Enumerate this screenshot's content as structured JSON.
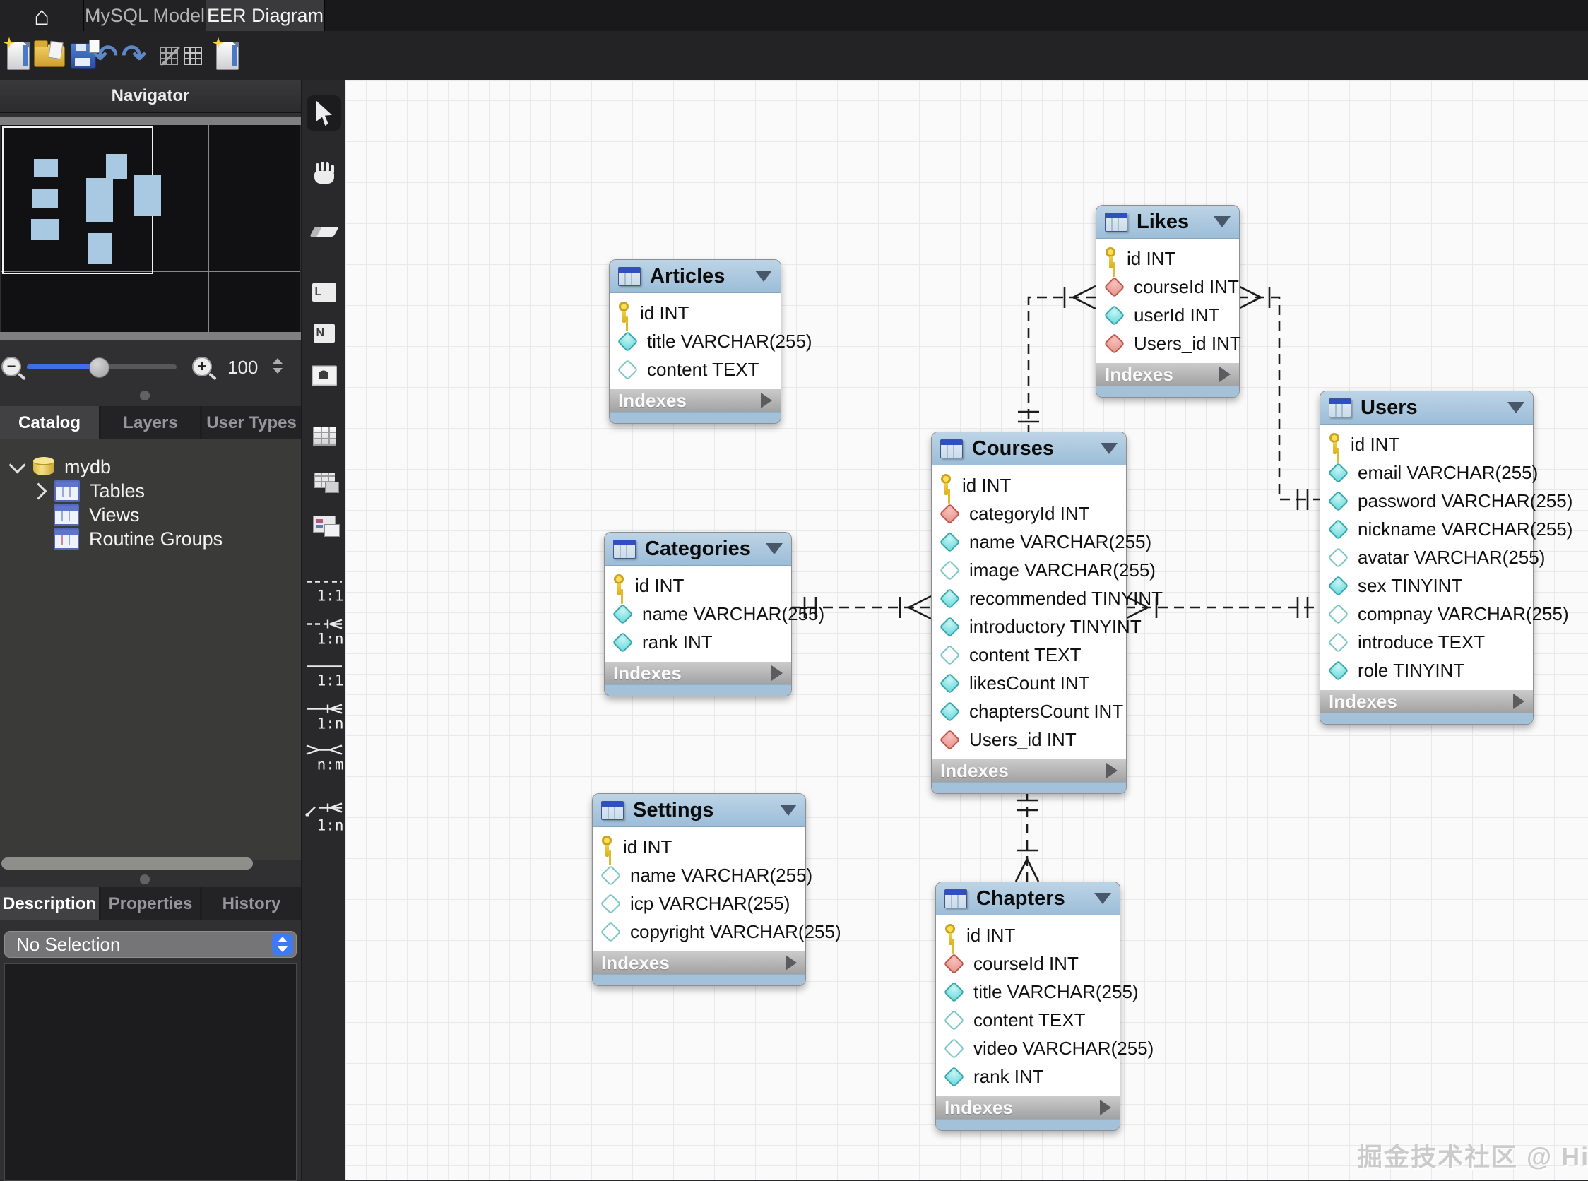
{
  "titlebar": {
    "model_tab": "MySQL Model",
    "diagram_tab": "EER Diagram"
  },
  "toolbar": {
    "icons": [
      "new-document",
      "open-model",
      "save-model",
      "undo",
      "redo",
      "toggle-grid-snap",
      "toggle-grid",
      "new-diagram"
    ]
  },
  "navigator": {
    "title": "Navigator",
    "zoom_value": "100"
  },
  "catalog": {
    "tabs": [
      "Catalog",
      "Layers",
      "User Types"
    ],
    "active_tab": "Catalog",
    "schema": "mydb",
    "tree": [
      "Tables",
      "Views",
      "Routine Groups"
    ]
  },
  "inspector": {
    "tabs": [
      "Description",
      "Properties",
      "History"
    ],
    "active_tab": "Description",
    "selection": "No Selection"
  },
  "palette": {
    "tools": [
      "select",
      "hand",
      "eraser",
      "layer",
      "note",
      "image",
      "table",
      "view",
      "routine-group"
    ],
    "relationship_tools": [
      {
        "label": "1:1",
        "line": "dashed"
      },
      {
        "label": "1:n",
        "line": "dashed"
      },
      {
        "label": "1:1",
        "line": "solid"
      },
      {
        "label": "1:n",
        "line": "solid"
      },
      {
        "label": "n:m",
        "line": "solid"
      },
      {
        "label": "1:n",
        "line": "solid-pick"
      }
    ]
  },
  "diagram": {
    "footer_label": "Indexes",
    "tables": [
      {
        "name": "Articles",
        "columns": [
          {
            "label": "id INT",
            "icon": "key"
          },
          {
            "label": "title VARCHAR(255)",
            "icon": "diamond-filled"
          },
          {
            "label": "content TEXT",
            "icon": "diamond-hollow"
          }
        ]
      },
      {
        "name": "Likes",
        "columns": [
          {
            "label": "id INT",
            "icon": "key"
          },
          {
            "label": "courseId INT",
            "icon": "diamond-fk"
          },
          {
            "label": "userId INT",
            "icon": "diamond-filled"
          },
          {
            "label": "Users_id INT",
            "icon": "diamond-fk"
          }
        ]
      },
      {
        "name": "Users",
        "columns": [
          {
            "label": "id INT",
            "icon": "key"
          },
          {
            "label": "email VARCHAR(255)",
            "icon": "diamond-filled"
          },
          {
            "label": "password VARCHAR(255)",
            "icon": "diamond-filled"
          },
          {
            "label": "nickname VARCHAR(255)",
            "icon": "diamond-filled"
          },
          {
            "label": "avatar VARCHAR(255)",
            "icon": "diamond-hollow"
          },
          {
            "label": "sex TINYINT",
            "icon": "diamond-filled"
          },
          {
            "label": "compnay VARCHAR(255)",
            "icon": "diamond-hollow"
          },
          {
            "label": "introduce TEXT",
            "icon": "diamond-hollow"
          },
          {
            "label": "role TINYINT",
            "icon": "diamond-filled"
          }
        ]
      },
      {
        "name": "Courses",
        "columns": [
          {
            "label": "id INT",
            "icon": "key"
          },
          {
            "label": "categoryId INT",
            "icon": "diamond-fk"
          },
          {
            "label": "name VARCHAR(255)",
            "icon": "diamond-filled"
          },
          {
            "label": "image VARCHAR(255)",
            "icon": "diamond-hollow"
          },
          {
            "label": "recommended TINYINT",
            "icon": "diamond-filled"
          },
          {
            "label": "introductory TINYINT",
            "icon": "diamond-filled"
          },
          {
            "label": "content TEXT",
            "icon": "diamond-hollow"
          },
          {
            "label": "likesCount INT",
            "icon": "diamond-filled"
          },
          {
            "label": "chaptersCount INT",
            "icon": "diamond-filled"
          },
          {
            "label": "Users_id INT",
            "icon": "diamond-fk"
          }
        ]
      },
      {
        "name": "Categories",
        "columns": [
          {
            "label": "id INT",
            "icon": "key"
          },
          {
            "label": "name VARCHAR(255)",
            "icon": "diamond-filled"
          },
          {
            "label": "rank INT",
            "icon": "diamond-filled"
          }
        ]
      },
      {
        "name": "Settings",
        "columns": [
          {
            "label": "id INT",
            "icon": "key"
          },
          {
            "label": "name VARCHAR(255)",
            "icon": "diamond-hollow"
          },
          {
            "label": "icp VARCHAR(255)",
            "icon": "diamond-hollow"
          },
          {
            "label": "copyright VARCHAR(255)",
            "icon": "diamond-hollow"
          }
        ]
      },
      {
        "name": "Chapters",
        "columns": [
          {
            "label": "id INT",
            "icon": "key"
          },
          {
            "label": "courseId INT",
            "icon": "diamond-fk"
          },
          {
            "label": "title VARCHAR(255)",
            "icon": "diamond-filled"
          },
          {
            "label": "content TEXT",
            "icon": "diamond-hollow"
          },
          {
            "label": "video VARCHAR(255)",
            "icon": "diamond-hollow"
          },
          {
            "label": "rank INT",
            "icon": "diamond-filled"
          }
        ]
      }
    ],
    "relationships": [
      {
        "from": "Categories",
        "to": "Courses",
        "cardinality": "1:n",
        "identifying": false
      },
      {
        "from": "Users",
        "to": "Courses",
        "cardinality": "1:n",
        "identifying": false
      },
      {
        "from": "Courses",
        "to": "Likes",
        "cardinality": "1:n",
        "identifying": false
      },
      {
        "from": "Users",
        "to": "Likes",
        "cardinality": "1:n",
        "identifying": false
      },
      {
        "from": "Courses",
        "to": "Chapters",
        "cardinality": "1:n",
        "identifying": false
      }
    ],
    "watermark": "掘金技术社区 @ HiSt"
  }
}
